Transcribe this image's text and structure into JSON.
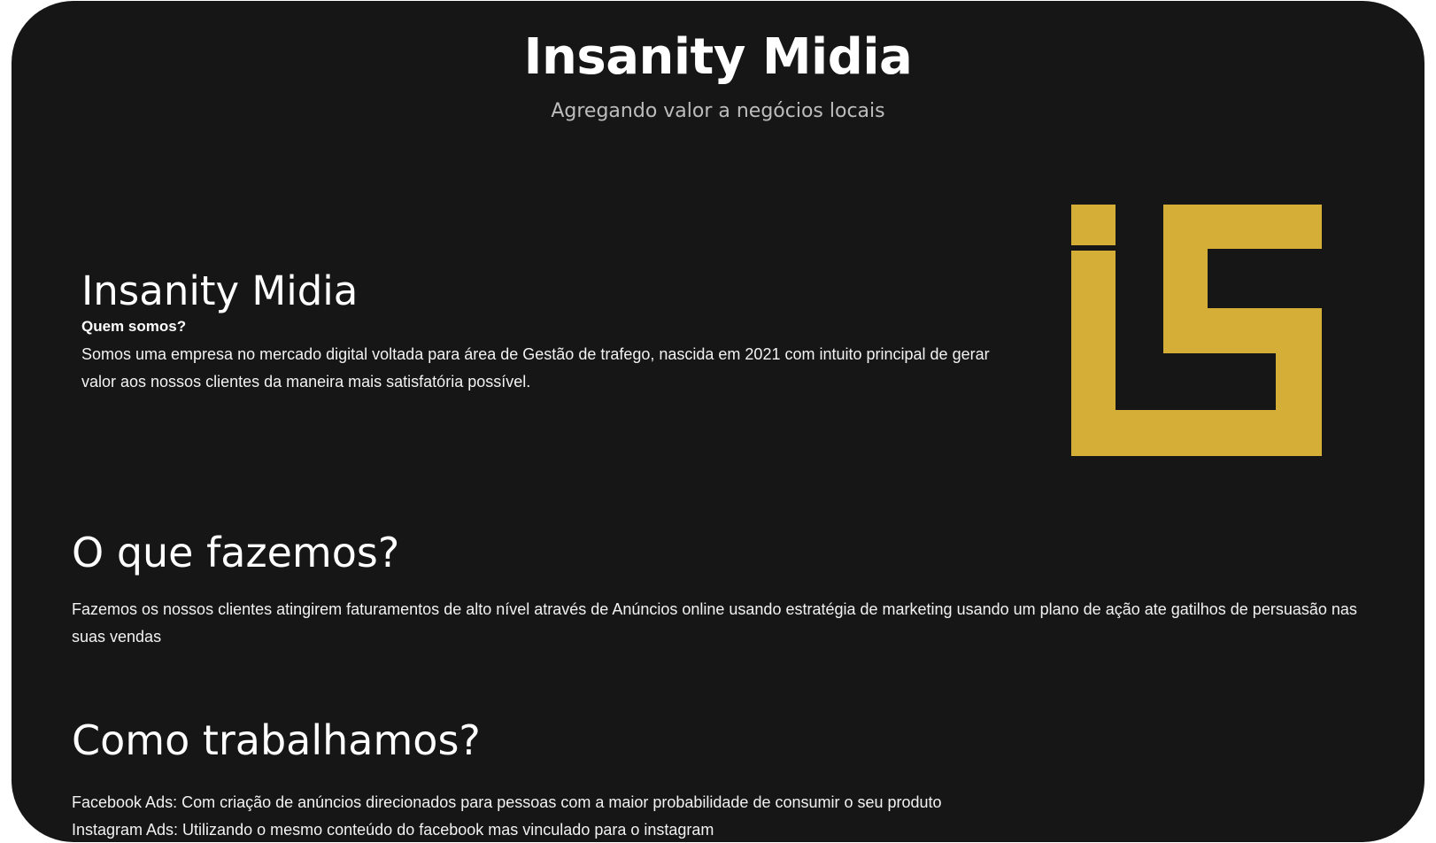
{
  "header": {
    "title": "Insanity Midia",
    "subtitle": "Agregando valor a negócios locais"
  },
  "about": {
    "title": "Insanity Midia",
    "subtitle": "Quem somos?",
    "text": "Somos uma empresa no mercado digital voltada para área de Gestão de trafego, nascida em 2021 com intuito principal de gerar valor aos nossos clientes da maneira mais satisfatória possível."
  },
  "logo": {
    "icon": "is-logo-icon",
    "color": "#d4ae36"
  },
  "what_we_do": {
    "heading": "O que fazemos?",
    "text": "Fazemos os nossos clientes atingirem faturamentos de alto nível através de Anúncios online usando estratégia de marketing usando um plano de ação ate gatilhos de persuasão nas suas vendas"
  },
  "how_we_work": {
    "heading": "Como trabalhamos?",
    "items": [
      "Facebook Ads: Com criação de anúncios direcionados para pessoas com a maior probabilidade de consumir o seu produto",
      "Instagram Ads: Utilizando o mesmo conteúdo do facebook mas vinculado para o instagram"
    ]
  }
}
